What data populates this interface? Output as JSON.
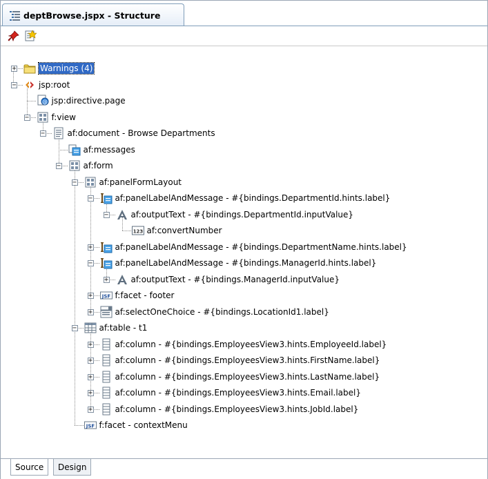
{
  "window": {
    "tab_title": "deptBrowse.jspx - Structure"
  },
  "toolbar": {
    "icons": [
      "pin-icon",
      "new-document-icon"
    ]
  },
  "tree": [
    {
      "label": "Warnings (4)",
      "icon": "folder-icon",
      "expander": "+",
      "selected": true
    },
    {
      "label": "jsp:root",
      "icon": "jsp-root-icon",
      "expander": "-"
    },
    {
      "label": "jsp:directive.page",
      "icon": "directive-icon"
    },
    {
      "label": "f:view",
      "icon": "view-icon",
      "expander": "-"
    },
    {
      "label": "af:document - Browse Departments",
      "icon": "document-icon",
      "expander": "-"
    },
    {
      "label": "af:messages",
      "icon": "messages-icon"
    },
    {
      "label": "af:form",
      "icon": "form-icon",
      "expander": "-"
    },
    {
      "label": "af:panelFormLayout",
      "icon": "panel-form-layout-icon",
      "expander": "-"
    },
    {
      "label": "af:panelLabelAndMessage - #{bindings.DepartmentId.hints.label}",
      "icon": "panel-label-icon",
      "expander": "-"
    },
    {
      "label": "af:outputText - #{bindings.DepartmentId.inputValue}",
      "icon": "output-text-icon",
      "expander": "-"
    },
    {
      "label": "af:convertNumber",
      "icon": "convert-number-icon"
    },
    {
      "label": "af:panelLabelAndMessage - #{bindings.DepartmentName.hints.label}",
      "icon": "panel-label-icon",
      "expander": "+"
    },
    {
      "label": "af:panelLabelAndMessage - #{bindings.ManagerId.hints.label}",
      "icon": "panel-label-icon",
      "expander": "-"
    },
    {
      "label": "af:outputText - #{bindings.ManagerId.inputValue}",
      "icon": "output-text-icon",
      "expander": "+"
    },
    {
      "label": "f:facet - footer",
      "icon": "jsf-facet-icon",
      "expander": "+"
    },
    {
      "label": "af:selectOneChoice - #{bindings.LocationId1.label}",
      "icon": "select-choice-icon",
      "expander": "+"
    },
    {
      "label": "af:table - t1",
      "icon": "table-icon",
      "expander": "-"
    },
    {
      "label": "af:column - #{bindings.EmployeesView3.hints.EmployeeId.label}",
      "icon": "column-icon",
      "expander": "+"
    },
    {
      "label": "af:column - #{bindings.EmployeesView3.hints.FirstName.label}",
      "icon": "column-icon",
      "expander": "+"
    },
    {
      "label": "af:column - #{bindings.EmployeesView3.hints.LastName.label}",
      "icon": "column-icon",
      "expander": "+"
    },
    {
      "label": "af:column - #{bindings.EmployeesView3.hints.Email.label}",
      "icon": "column-icon",
      "expander": "+"
    },
    {
      "label": "af:column - #{bindings.EmployeesView3.hints.JobId.label}",
      "icon": "column-icon",
      "expander": "+"
    },
    {
      "label": "f:facet - contextMenu",
      "icon": "jsf-facet-icon"
    }
  ],
  "bottom_tabs": [
    {
      "label": "Source",
      "active": true
    },
    {
      "label": "Design",
      "active": false
    }
  ],
  "icon_text": {
    "jsf": "JSF",
    "num": "123"
  },
  "colors": {
    "selection": "#316ac5",
    "border": "#7f9db9"
  }
}
